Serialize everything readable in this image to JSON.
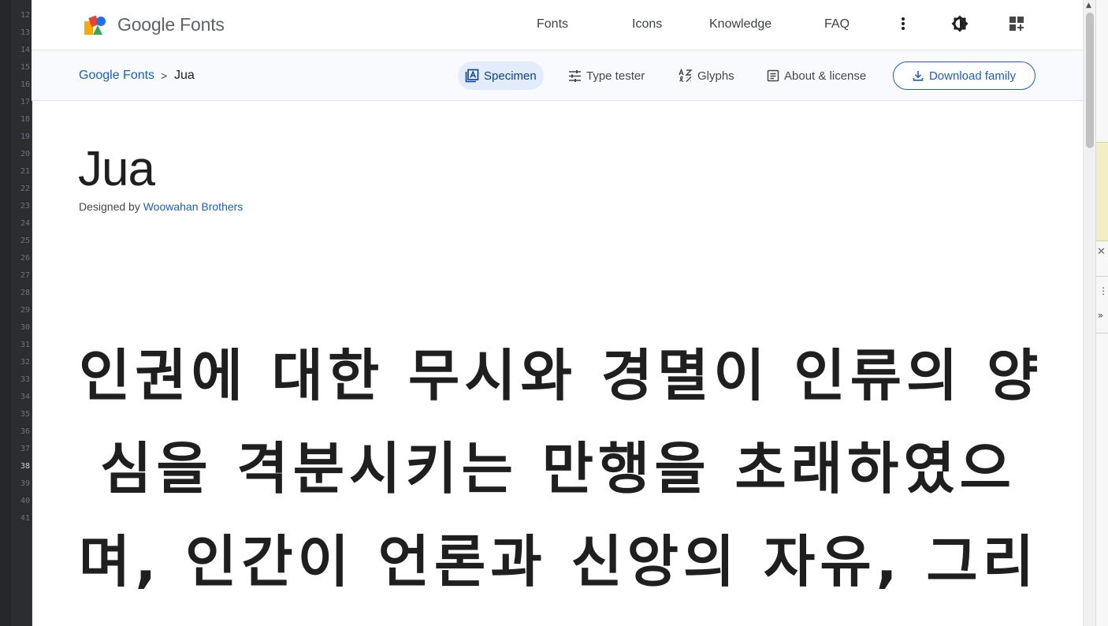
{
  "editor": {
    "line_numbers": [
      "12",
      "13",
      "14",
      "15",
      "16",
      "17",
      "18",
      "19",
      "20",
      "21",
      "22",
      "23",
      "24",
      "25",
      "26",
      "27",
      "28",
      "29",
      "30",
      "31",
      "32",
      "33",
      "34",
      "35",
      "36",
      "37",
      "38",
      "39",
      "40",
      "41"
    ],
    "active_line": "38"
  },
  "header": {
    "brand": "Google Fonts",
    "nav": [
      "Fonts",
      "Icons",
      "Knowledge",
      "FAQ"
    ],
    "icons": [
      "more-vert-icon",
      "theme-toggle-icon",
      "apps-add-icon"
    ]
  },
  "subheader": {
    "breadcrumb_root": "Google Fonts",
    "breadcrumb_sep": ">",
    "breadcrumb_current": "Jua",
    "tabs": [
      {
        "label": "Specimen",
        "icon": "specimen-icon",
        "active": true
      },
      {
        "label": "Type tester",
        "icon": "tune-icon",
        "active": false
      },
      {
        "label": "Glyphs",
        "icon": "glyphs-icon",
        "active": false
      },
      {
        "label": "About & license",
        "icon": "article-icon",
        "active": false
      }
    ],
    "download_label": "Download family"
  },
  "main": {
    "family_name": "Jua",
    "designed_by_prefix": "Designed by",
    "designer": "Woowahan Brothers",
    "specimen_lines": [
      "인권에 대한 무시와 경멸이 인류의 양",
      "심을 격분시키는 만행을 초래하였으",
      "며, 인간이 언론과 신앙의 자유, 그리"
    ]
  },
  "colors": {
    "accent": "#1a5fc7",
    "active_tab_bg": "#e3ecfb",
    "subheader_bg": "#f8fafd"
  }
}
